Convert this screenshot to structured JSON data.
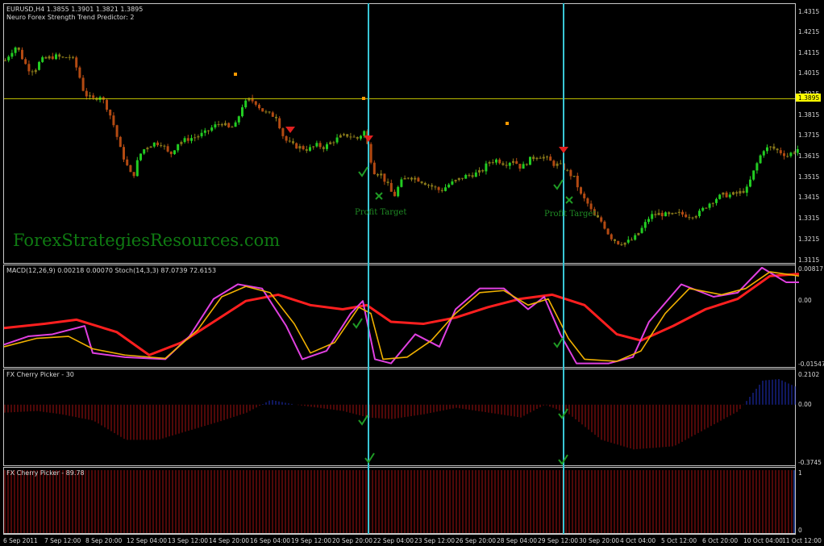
{
  "main": {
    "title": "EURUSD,H4 1.3855 1.3901 1.3821 1.3895",
    "indicator": "Neuro Forex Strength Trend Predictor: 2",
    "watermark": "ForexStrategiesResources.com",
    "current_price": "1.3895",
    "annotations": [
      "Profit Target",
      "Profit Target"
    ]
  },
  "panels": {
    "macd_label": "MACD(12,26,9) 0.00218 0.00070  Stoch(14,3,3) 87.0739 72.6153",
    "cherry30_label": "FX Cherry Picker - 30",
    "cherry89_label": "FX Cherry Picker - 89.78"
  },
  "colors": {
    "bull": "#22cc22",
    "bear": "#b34a12",
    "neutral": "#8a7a1a",
    "vline": "#39c6d6",
    "hline": "#c8c800",
    "macd_signal": "#ff1f1f",
    "stoch_main": "#e040e0",
    "stoch_signal": "#f0b000",
    "hist_red": "#a01010",
    "hist_blue": "#2030c0",
    "arrow": "#e02020",
    "check": "#1f9a24",
    "dot": "#ff9a00"
  },
  "chart_data": [
    {
      "type": "candlestick",
      "title": "EURUSD,H4 1.3855 1.3901 1.3821 1.3895",
      "y_ticks": [
        "1.4315",
        "1.4215",
        "1.4115",
        "1.4015",
        "1.3915",
        "1.3815",
        "1.3715",
        "1.3615",
        "1.3515",
        "1.3415",
        "1.3315",
        "1.3215",
        "1.3115"
      ],
      "ylim": [
        1.311,
        1.434
      ],
      "close_path": [
        [
          0,
          1.408
        ],
        [
          7,
          1.412
        ],
        [
          14,
          1.415
        ],
        [
          20,
          1.41
        ],
        [
          28,
          1.404
        ],
        [
          36,
          1.403
        ],
        [
          44,
          1.408
        ],
        [
          52,
          1.409
        ],
        [
          62,
          1.41
        ],
        [
          72,
          1.409
        ],
        [
          82,
          1.41
        ],
        [
          90,
          1.403
        ],
        [
          98,
          1.392
        ],
        [
          108,
          1.389
        ],
        [
          118,
          1.391
        ],
        [
          128,
          1.384
        ],
        [
          136,
          1.375
        ],
        [
          142,
          1.366
        ],
        [
          150,
          1.358
        ],
        [
          158,
          1.351
        ],
        [
          166,
          1.362
        ],
        [
          174,
          1.366
        ],
        [
          184,
          1.368
        ],
        [
          194,
          1.368
        ],
        [
          204,
          1.362
        ],
        [
          214,
          1.368
        ],
        [
          226,
          1.37
        ],
        [
          236,
          1.371
        ],
        [
          248,
          1.373
        ],
        [
          258,
          1.376
        ],
        [
          268,
          1.378
        ],
        [
          278,
          1.375
        ],
        [
          286,
          1.377
        ],
        [
          294,
          1.386
        ],
        [
          302,
          1.389
        ],
        [
          310,
          1.388
        ],
        [
          318,
          1.384
        ],
        [
          326,
          1.382
        ],
        [
          336,
          1.381
        ],
        [
          346,
          1.37
        ],
        [
          356,
          1.367
        ],
        [
          366,
          1.366
        ],
        [
          376,
          1.365
        ],
        [
          386,
          1.367
        ],
        [
          396,
          1.366
        ],
        [
          406,
          1.369
        ],
        [
          416,
          1.371
        ],
        [
          426,
          1.372
        ],
        [
          436,
          1.37
        ],
        [
          446,
          1.374
        ],
        [
          452,
          1.362
        ],
        [
          458,
          1.354
        ],
        [
          466,
          1.353
        ],
        [
          474,
          1.348
        ],
        [
          482,
          1.342
        ],
        [
          490,
          1.349
        ],
        [
          500,
          1.352
        ],
        [
          510,
          1.351
        ],
        [
          520,
          1.349
        ],
        [
          530,
          1.347
        ],
        [
          540,
          1.345
        ],
        [
          550,
          1.348
        ],
        [
          560,
          1.35
        ],
        [
          570,
          1.352
        ],
        [
          580,
          1.353
        ],
        [
          590,
          1.354
        ],
        [
          600,
          1.359
        ],
        [
          610,
          1.36
        ],
        [
          620,
          1.358
        ],
        [
          630,
          1.36
        ],
        [
          640,
          1.356
        ],
        [
          650,
          1.36
        ],
        [
          660,
          1.362
        ],
        [
          670,
          1.361
        ],
        [
          680,
          1.358
        ],
        [
          690,
          1.357
        ],
        [
          698,
          1.354
        ],
        [
          706,
          1.351
        ],
        [
          714,
          1.343
        ],
        [
          722,
          1.339
        ],
        [
          730,
          1.333
        ],
        [
          740,
          1.33
        ],
        [
          750,
          1.323
        ],
        [
          760,
          1.32
        ],
        [
          770,
          1.32
        ],
        [
          780,
          1.322
        ],
        [
          790,
          1.327
        ],
        [
          800,
          1.333
        ],
        [
          812,
          1.334
        ],
        [
          824,
          1.333
        ],
        [
          836,
          1.334
        ],
        [
          848,
          1.333
        ],
        [
          860,
          1.334
        ],
        [
          870,
          1.338
        ],
        [
          880,
          1.341
        ],
        [
          890,
          1.343
        ],
        [
          900,
          1.343
        ],
        [
          910,
          1.344
        ],
        [
          920,
          1.346
        ],
        [
          930,
          1.356
        ],
        [
          940,
          1.365
        ],
        [
          950,
          1.366
        ],
        [
          960,
          1.364
        ],
        [
          970,
          1.362
        ],
        [
          986,
          1.366
        ]
      ]
    },
    {
      "type": "line",
      "title": "MACD(12,26,9) 0.00218 0.00070  Stoch(14,3,3) 87.0739 72.6153",
      "y_ticks": [
        "0.00817",
        "0.00",
        "-0.01547"
      ],
      "ylim": [
        -0.01547,
        0.00817
      ],
      "series": [
        {
          "points": [
            [
              0,
              -0.0065
            ],
            [
              50,
              -0.0055
            ],
            [
              90,
              -0.0045
            ],
            [
              140,
              -0.0075
            ],
            [
              180,
              -0.013
            ],
            [
              220,
              -0.01
            ],
            [
              260,
              -0.005
            ],
            [
              300,
              0.0
            ],
            [
              340,
              0.0015
            ],
            [
              380,
              -0.001
            ],
            [
              420,
              -0.002
            ],
            [
              450,
              -0.001
            ],
            [
              480,
              -0.005
            ],
            [
              520,
              -0.0055
            ],
            [
              560,
              -0.004
            ],
            [
              600,
              -0.0015
            ],
            [
              640,
              0.0005
            ],
            [
              680,
              0.0015
            ],
            [
              720,
              -0.001
            ],
            [
              760,
              -0.008
            ],
            [
              790,
              -0.0095
            ],
            [
              830,
              -0.006
            ],
            [
              870,
              -0.002
            ],
            [
              910,
              0.0005
            ],
            [
              950,
              0.006
            ],
            [
              986,
              0.0065
            ]
          ]
        },
        {
          "points": [
            [
              0,
              -0.0105
            ],
            [
              30,
              -0.0085
            ],
            [
              60,
              -0.008
            ],
            [
              100,
              -0.006
            ],
            [
              110,
              -0.0125
            ],
            [
              150,
              -0.0135
            ],
            [
              200,
              -0.014
            ],
            [
              230,
              -0.0085
            ],
            [
              260,
              0.0005
            ],
            [
              290,
              0.004
            ],
            [
              320,
              0.003
            ],
            [
              350,
              -0.006
            ],
            [
              370,
              -0.014
            ],
            [
              400,
              -0.012
            ],
            [
              430,
              -0.003
            ],
            [
              445,
              0.0
            ],
            [
              460,
              -0.014
            ],
            [
              480,
              -0.015
            ],
            [
              510,
              -0.008
            ],
            [
              540,
              -0.011
            ],
            [
              560,
              -0.002
            ],
            [
              590,
              0.003
            ],
            [
              620,
              0.003
            ],
            [
              650,
              -0.002
            ],
            [
              670,
              0.001
            ],
            [
              690,
              -0.008
            ],
            [
              710,
              -0.015
            ],
            [
              750,
              -0.015
            ],
            [
              780,
              -0.0135
            ],
            [
              800,
              -0.005
            ],
            [
              840,
              0.004
            ],
            [
              880,
              0.001
            ],
            [
              910,
              0.002
            ],
            [
              940,
              0.008
            ],
            [
              970,
              0.0045
            ],
            [
              986,
              0.0045
            ]
          ]
        },
        {
          "points": [
            [
              0,
              -0.011
            ],
            [
              40,
              -0.009
            ],
            [
              80,
              -0.0085
            ],
            [
              110,
              -0.0115
            ],
            [
              150,
              -0.013
            ],
            [
              200,
              -0.0138
            ],
            [
              240,
              -0.007
            ],
            [
              270,
              0.001
            ],
            [
              300,
              0.0035
            ],
            [
              330,
              0.002
            ],
            [
              360,
              -0.0055
            ],
            [
              380,
              -0.0125
            ],
            [
              410,
              -0.01
            ],
            [
              440,
              -0.0015
            ],
            [
              455,
              -0.003
            ],
            [
              470,
              -0.014
            ],
            [
              500,
              -0.0135
            ],
            [
              530,
              -0.0095
            ],
            [
              560,
              -0.003
            ],
            [
              590,
              0.002
            ],
            [
              620,
              0.0025
            ],
            [
              650,
              -0.001
            ],
            [
              675,
              0.0005
            ],
            [
              700,
              -0.009
            ],
            [
              720,
              -0.014
            ],
            [
              760,
              -0.0145
            ],
            [
              790,
              -0.012
            ],
            [
              820,
              -0.003
            ],
            [
              850,
              0.003
            ],
            [
              890,
              0.0015
            ],
            [
              920,
              0.003
            ],
            [
              950,
              0.007
            ],
            [
              986,
              0.006
            ]
          ]
        }
      ]
    },
    {
      "type": "bar",
      "title": "FX Cherry Picker - 30",
      "y_ticks": [
        "0.2102",
        "0.00",
        "-0.3745"
      ],
      "ylim": [
        -0.3745,
        0.2102
      ],
      "envelope": [
        [
          0,
          -0.05
        ],
        [
          40,
          -0.04
        ],
        [
          70,
          -0.06
        ],
        [
          110,
          -0.1
        ],
        [
          150,
          -0.22
        ],
        [
          190,
          -0.22
        ],
        [
          230,
          -0.16
        ],
        [
          270,
          -0.1
        ],
        [
          300,
          -0.05
        ],
        [
          330,
          0.03
        ],
        [
          360,
          0.0
        ],
        [
          390,
          -0.02
        ],
        [
          420,
          -0.04
        ],
        [
          450,
          -0.08
        ],
        [
          480,
          -0.09
        ],
        [
          520,
          -0.06
        ],
        [
          560,
          -0.02
        ],
        [
          600,
          -0.05
        ],
        [
          640,
          -0.08
        ],
        [
          670,
          0.0
        ],
        [
          700,
          -0.06
        ],
        [
          740,
          -0.22
        ],
        [
          780,
          -0.28
        ],
        [
          830,
          -0.26
        ],
        [
          870,
          -0.15
        ],
        [
          910,
          -0.04
        ],
        [
          940,
          0.15
        ],
        [
          960,
          0.16
        ],
        [
          986,
          0.1
        ]
      ]
    },
    {
      "type": "bar",
      "title": "FX Cherry Picker - 89.78",
      "y_ticks": [
        "1",
        "0"
      ],
      "ylim": [
        0,
        1
      ],
      "value": 1
    }
  ],
  "x_ticks": [
    "6 Sep 2011",
    "7 Sep 12:00",
    "8 Sep 20:00",
    "12 Sep 04:00",
    "13 Sep 12:00",
    "14 Sep 20:00",
    "16 Sep 04:00",
    "19 Sep 12:00",
    "20 Sep 20:00",
    "22 Sep 04:00",
    "23 Sep 12:00",
    "26 Sep 20:00",
    "28 Sep 04:00",
    "29 Sep 12:00",
    "30 Sep 20:00",
    "4 Oct 04:00",
    "5 Oct 12:00",
    "6 Oct 20:00",
    "10 Oct 04:00",
    "11 Oct 12:00"
  ]
}
